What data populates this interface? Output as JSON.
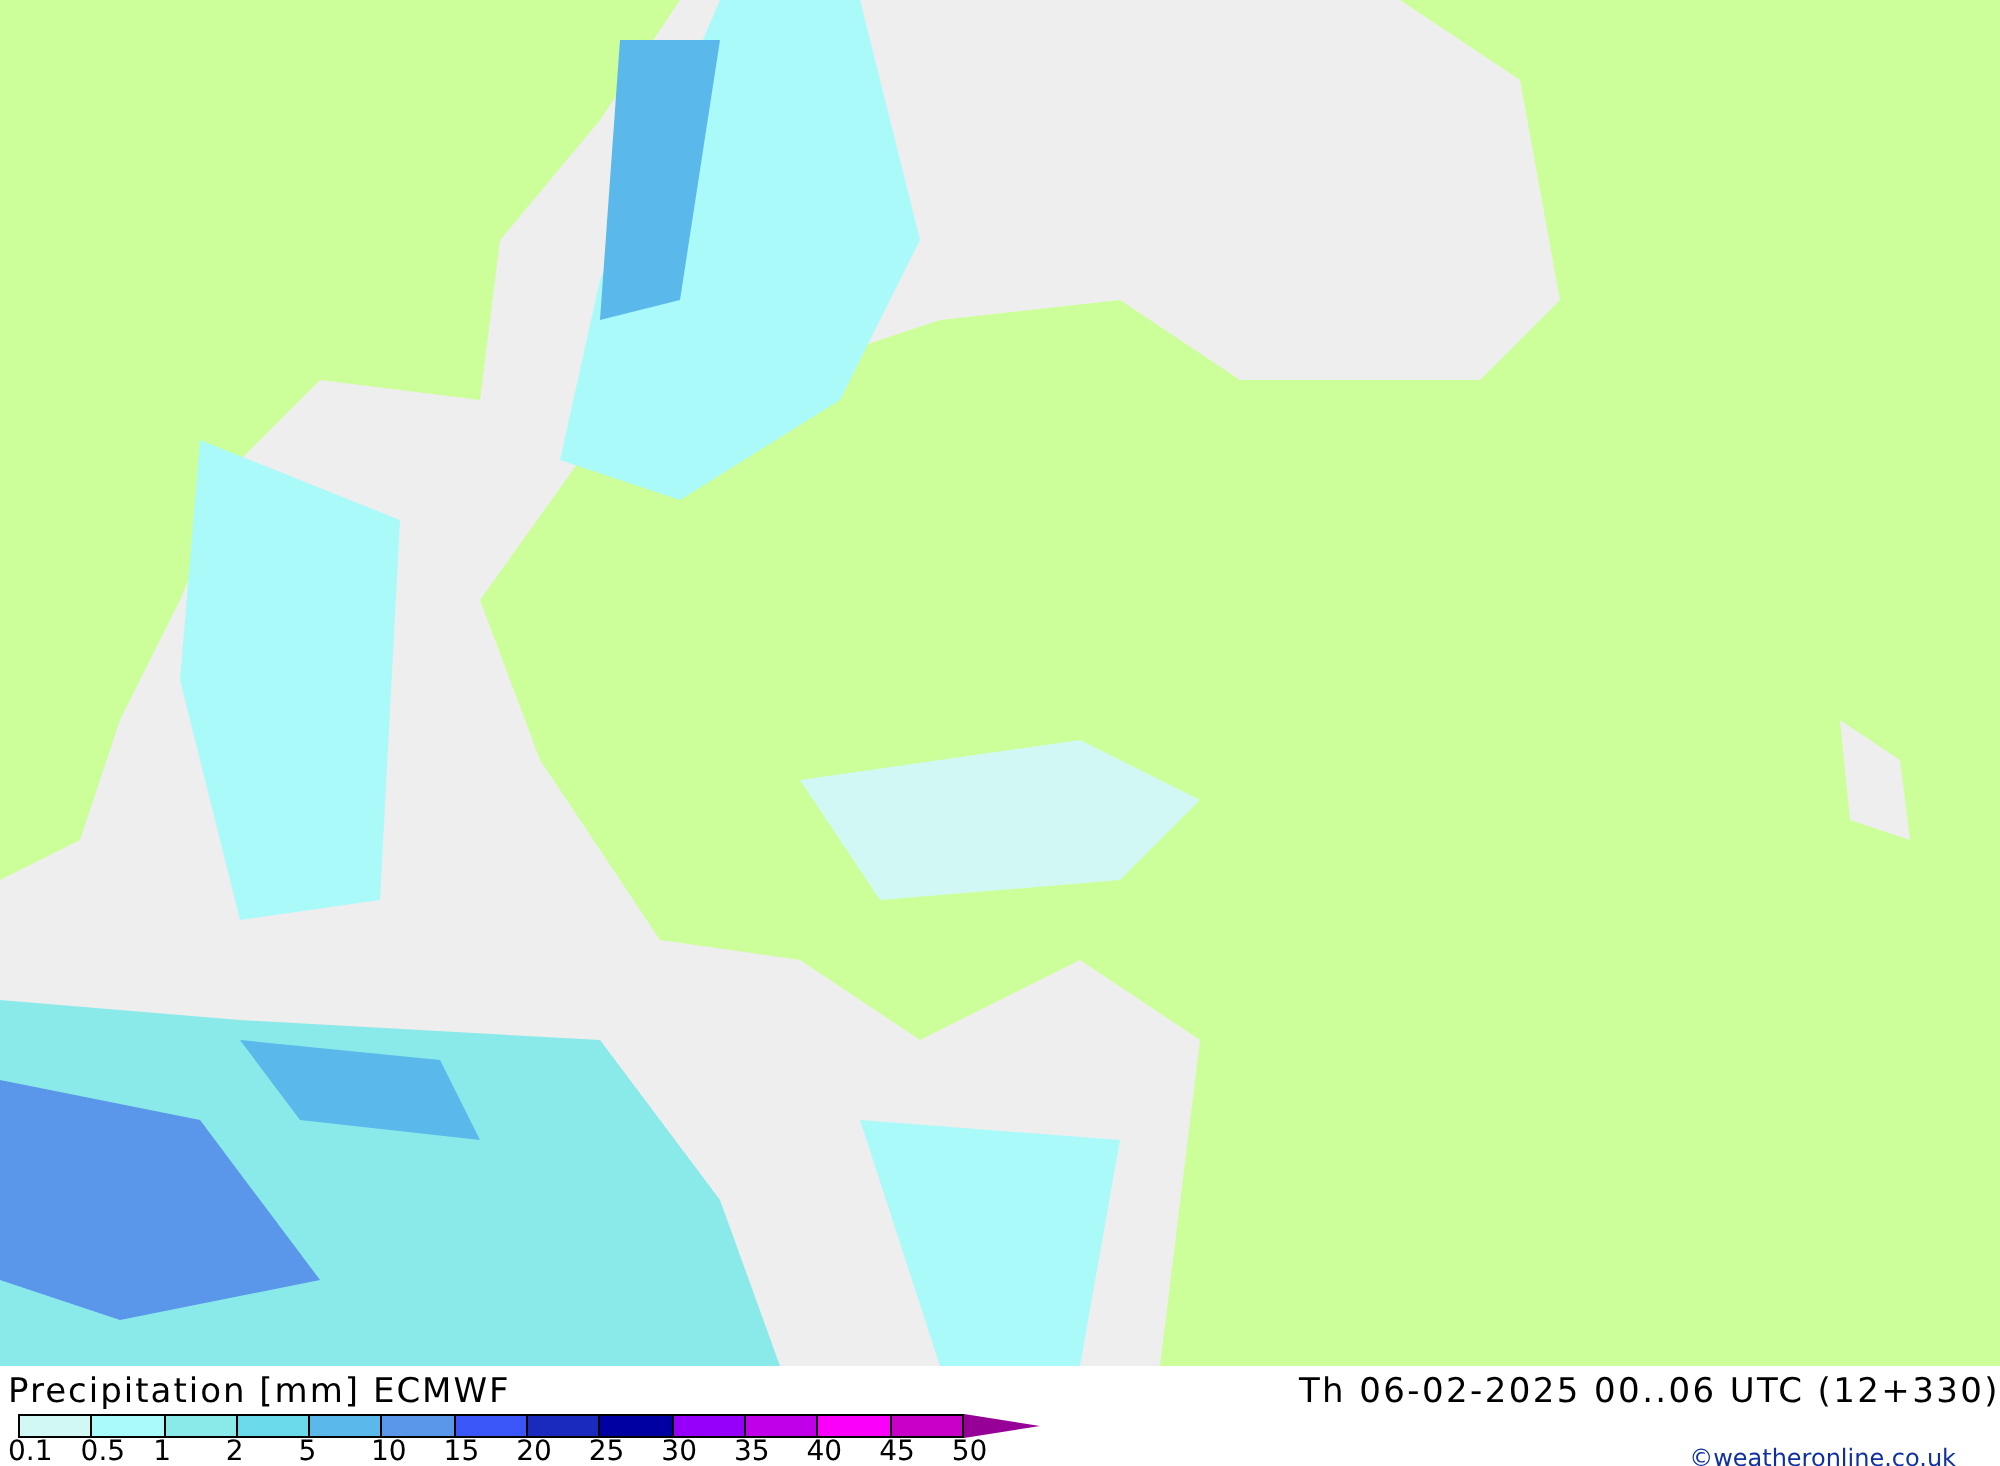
{
  "title": "Precipitation [mm] ECMWF",
  "valid_time": "Th 06-02-2025 00..06 UTC (12+330)",
  "scale": {
    "bins": [
      {
        "color": "#d2f8f6"
      },
      {
        "color": "#aafafa"
      },
      {
        "color": "#8aeaea"
      },
      {
        "color": "#6adaea"
      },
      {
        "color": "#5ab8ea"
      },
      {
        "color": "#5a96ea"
      },
      {
        "color": "#3a56f6"
      },
      {
        "color": "#1a2abc"
      },
      {
        "color": "#0000a2"
      },
      {
        "color": "#9600fa"
      },
      {
        "color": "#c000e8"
      },
      {
        "color": "#fa00fa"
      },
      {
        "color": "#c800c8"
      }
    ],
    "labels": [
      "0.1",
      "0.5",
      "1",
      "2",
      "5",
      "10",
      "15",
      "20",
      "25",
      "30",
      "35",
      "40",
      "45",
      "50"
    ],
    "arrow": {
      "color": "#960096"
    }
  },
  "credit": "©weatheronline.co.uk"
}
